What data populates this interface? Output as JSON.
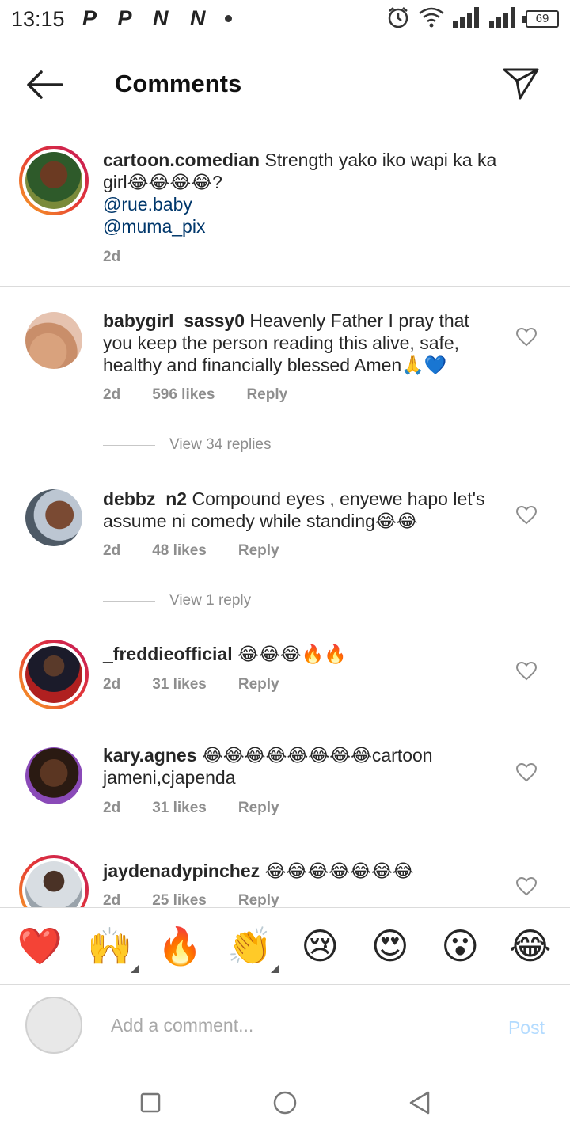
{
  "status_bar": {
    "time": "13:15",
    "notification_letters": "P P N N",
    "battery": "69"
  },
  "header": {
    "title": "Comments",
    "back_icon": "arrow-left-icon",
    "send_icon": "paper-plane-icon"
  },
  "caption": {
    "username": "cartoon.comedian",
    "text": "Strength yako iko wapi ka ka girl😂😂😂😂?",
    "mentions": [
      "@rue.baby",
      "@muma_pix"
    ],
    "time": "2d"
  },
  "comments": [
    {
      "username": "babygirl_sassy0",
      "text": "Heavenly Father I pray that you keep the person reading this alive, safe, healthy and financially blessed Amen🙏💙",
      "time": "2d",
      "likes": "596 likes",
      "reply_label": "Reply",
      "view_replies": "View 34 replies"
    },
    {
      "username": "debbz_n2",
      "text": "Compound eyes , enyewe hapo let's assume ni comedy while standing😂😂",
      "time": "2d",
      "likes": "48 likes",
      "reply_label": "Reply",
      "view_replies": "View 1 reply"
    },
    {
      "username": "_freddieofficial",
      "text": "😂😂😂🔥🔥",
      "time": "2d",
      "likes": "31 likes",
      "reply_label": "Reply"
    },
    {
      "username": "kary.agnes",
      "text": "😂😂😂😂😂😂😂😂cartoon jameni,cjapenda",
      "time": "2d",
      "likes": "31 likes",
      "reply_label": "Reply"
    },
    {
      "username": "jaydenadypinchez",
      "text": "😂😂😂😂😂😂😂",
      "time": "2d",
      "likes": "25 likes",
      "reply_label": "Reply"
    }
  ],
  "emoji_bar": [
    "❤️",
    "🙌",
    "🔥",
    "👏",
    "😢",
    "😍",
    "😮",
    "😂"
  ],
  "input": {
    "placeholder": "Add a comment...",
    "post_label": "Post"
  },
  "colors": {
    "mention": "#00376b",
    "meta_gray": "#8e8e8e",
    "post_disabled": "#b3dbff"
  }
}
